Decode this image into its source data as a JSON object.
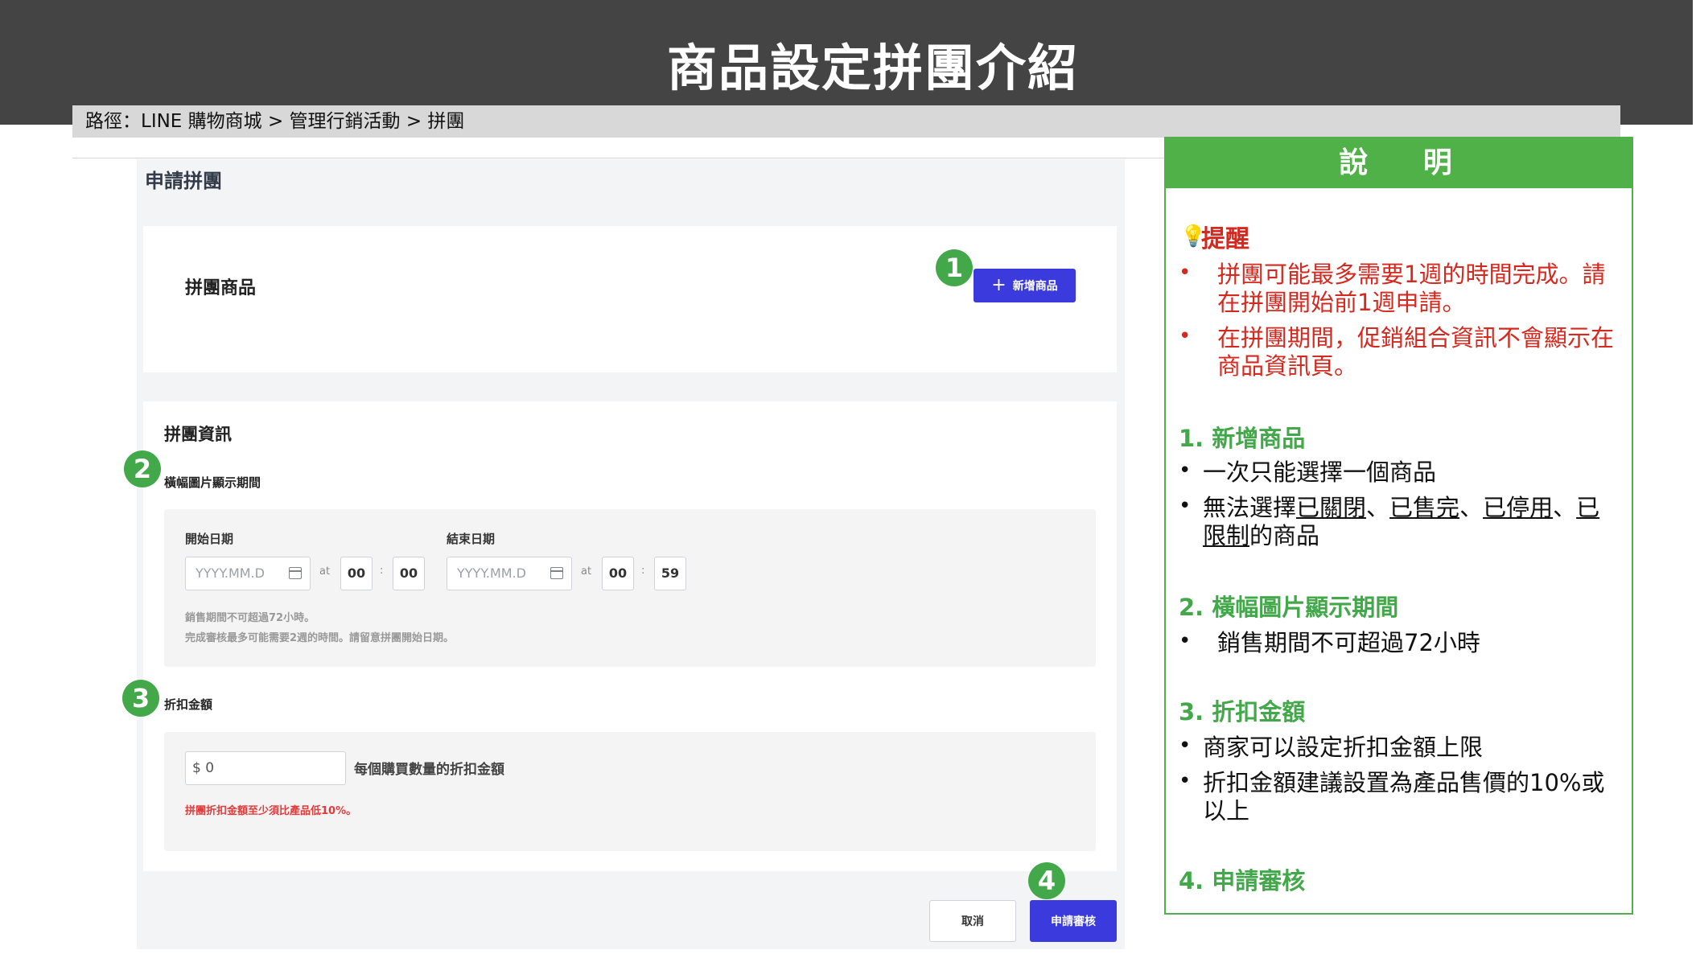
{
  "title": "商品設定拼團介紹",
  "breadcrumb": "路徑：LINE 購物商城 > 管理行銷活動 > 拼團",
  "form": {
    "heading": "申請拼團",
    "product_section_label": "拼團商品",
    "add_product_label": "新增商品",
    "info_title": "拼團資訊",
    "banner_period_label": "橫幅圖片顯示期間",
    "start_date_label": "開始日期",
    "end_date_label": "結束日期",
    "date_placeholder": "YYYY.MM.D",
    "at_label": "at",
    "colon": ":",
    "start_hour": "00",
    "start_minute": "00",
    "end_hour": "00",
    "end_minute": "59",
    "help_line1": "銷售期間不可超過72小時。",
    "help_line2": "完成審核最多可能需要2週的時間。請留意拼團開始日期。",
    "discount_label": "折扣金額",
    "discount_value": "$ 0",
    "discount_note": "每個購買數量的折扣金額",
    "discount_warning": "拼團折扣金額至少須比產品低10%。",
    "cancel_label": "取消",
    "submit_label": "申請審核"
  },
  "steps": [
    "1",
    "2",
    "3",
    "4"
  ],
  "explain": {
    "header": "說 明",
    "remind_title": "提醒",
    "remind_items": [
      "拼團可能最多需要1週的時間完成。請在拼團開始前1週申請。",
      "在拼團期間，促銷組合資訊不會顯示在商品資訊頁。"
    ],
    "s1_title": "1. 新增商品",
    "s1_item1": "一次只能選擇一個商品",
    "s1_item2_prefix": "無法選擇",
    "s1_item2_a": "已關閉",
    "s1_item2_sep1": "、",
    "s1_item2_b": "已售完",
    "s1_item2_sep2": "、",
    "s1_item2_c": "已停用",
    "s1_item2_sep3": "、",
    "s1_item2_d": "已限制",
    "s1_item2_suffix": "的商品",
    "s2_title": "2. 橫幅圖片顯示期間",
    "s2_item1": "銷售期間不可超過72小時",
    "s3_title": "3. 折扣金額",
    "s3_item1": "商家可以設定折扣金額上限",
    "s3_item2": "折扣金額建議設置為產品售價的10%或以上",
    "s4_title": "4. 申請審核"
  },
  "colors": {
    "top_bar": "#444444",
    "accent_green": "#43a84a",
    "primary_button": "#3b3bdd",
    "warning_red": "#d3291f"
  }
}
